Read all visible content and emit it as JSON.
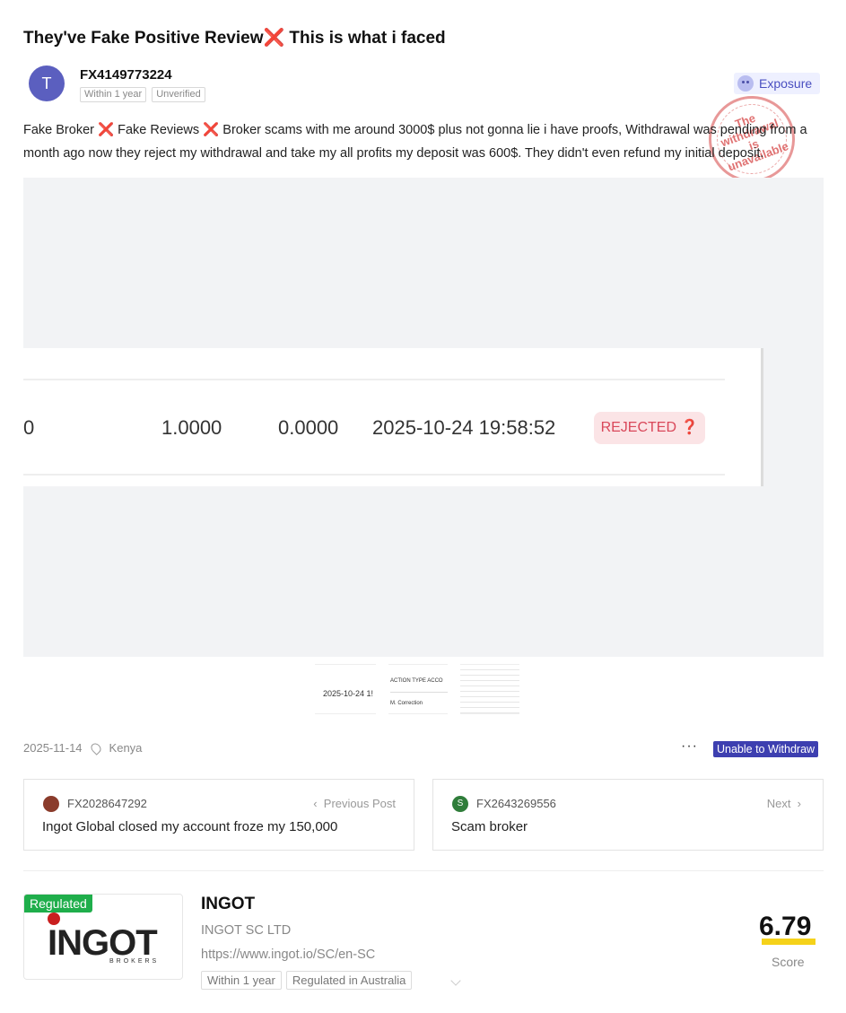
{
  "post": {
    "title": "They've Fake Positive Review",
    "title_mark": "❌",
    "title_suffix": " This is what i faced",
    "avatar_letter": "T",
    "username": "FX4149773224",
    "tags": [
      "Within 1 year",
      "Unverified"
    ],
    "category": "Exposure",
    "stamp_text": "The withdrawal is unavailable",
    "body": {
      "p1": "Fake Broker ",
      "p2": " Fake Reviews ",
      "p3": " Broker scams with me around 3000$ plus not gonna lie i have proofs, Withdrawal was pending from a month ago now they reject my withdrawal and take my all profits my deposit was 600$. They didn't even refund my initial deposit.",
      "mark": "❌"
    }
  },
  "screenshot": {
    "cells": [
      "0",
      "1.0000",
      "0.0000",
      "2025-10-24 19:58:52"
    ],
    "status": "REJECTED ❓"
  },
  "thumbnails": {
    "t1": "2025-10-24 1!",
    "t2_header": "ACTION TYPE     ACCO",
    "t2_row": "M. Correction"
  },
  "meta": {
    "date": "2025-11-14",
    "location": "Kenya",
    "more": "···",
    "badge": "Unable to Withdraw"
  },
  "nav": {
    "prev": {
      "user": "FX2028647292",
      "dir": "Previous Post",
      "title": "Ingot Global closed my account froze my 150,000"
    },
    "next": {
      "user": "FX2643269556",
      "avatar_letter": "S",
      "dir": "Next",
      "title": "Scam broker"
    }
  },
  "broker": {
    "regulated_label": "Regulated",
    "logo_text": "INGOT",
    "logo_sub": "BROKERS",
    "name": "INGOT",
    "company": "INGOT SC LTD",
    "url": "https://www.ingot.io/SC/en-SC",
    "tags": [
      "Within 1 year",
      "Regulated in Australia"
    ],
    "score": "6.79",
    "score_label": "Score"
  },
  "colors": {
    "accent": "#3d3fb0",
    "mark": "#e8466b",
    "rejected_bg": "#fbe4e6",
    "rejected_text": "#d9485a",
    "score_highlight": "#f5d21a",
    "regulated": "#1fae4b"
  }
}
